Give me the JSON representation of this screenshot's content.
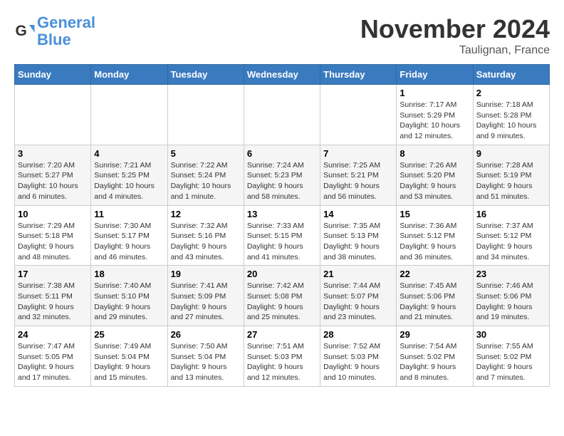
{
  "header": {
    "logo_line1": "General",
    "logo_line2": "Blue",
    "month": "November 2024",
    "location": "Taulignan, France"
  },
  "weekdays": [
    "Sunday",
    "Monday",
    "Tuesday",
    "Wednesday",
    "Thursday",
    "Friday",
    "Saturday"
  ],
  "weeks": [
    [
      {
        "day": "",
        "info": ""
      },
      {
        "day": "",
        "info": ""
      },
      {
        "day": "",
        "info": ""
      },
      {
        "day": "",
        "info": ""
      },
      {
        "day": "",
        "info": ""
      },
      {
        "day": "1",
        "info": "Sunrise: 7:17 AM\nSunset: 5:29 PM\nDaylight: 10 hours and 12 minutes."
      },
      {
        "day": "2",
        "info": "Sunrise: 7:18 AM\nSunset: 5:28 PM\nDaylight: 10 hours and 9 minutes."
      }
    ],
    [
      {
        "day": "3",
        "info": "Sunrise: 7:20 AM\nSunset: 5:27 PM\nDaylight: 10 hours and 6 minutes."
      },
      {
        "day": "4",
        "info": "Sunrise: 7:21 AM\nSunset: 5:25 PM\nDaylight: 10 hours and 4 minutes."
      },
      {
        "day": "5",
        "info": "Sunrise: 7:22 AM\nSunset: 5:24 PM\nDaylight: 10 hours and 1 minute."
      },
      {
        "day": "6",
        "info": "Sunrise: 7:24 AM\nSunset: 5:23 PM\nDaylight: 9 hours and 58 minutes."
      },
      {
        "day": "7",
        "info": "Sunrise: 7:25 AM\nSunset: 5:21 PM\nDaylight: 9 hours and 56 minutes."
      },
      {
        "day": "8",
        "info": "Sunrise: 7:26 AM\nSunset: 5:20 PM\nDaylight: 9 hours and 53 minutes."
      },
      {
        "day": "9",
        "info": "Sunrise: 7:28 AM\nSunset: 5:19 PM\nDaylight: 9 hours and 51 minutes."
      }
    ],
    [
      {
        "day": "10",
        "info": "Sunrise: 7:29 AM\nSunset: 5:18 PM\nDaylight: 9 hours and 48 minutes."
      },
      {
        "day": "11",
        "info": "Sunrise: 7:30 AM\nSunset: 5:17 PM\nDaylight: 9 hours and 46 minutes."
      },
      {
        "day": "12",
        "info": "Sunrise: 7:32 AM\nSunset: 5:16 PM\nDaylight: 9 hours and 43 minutes."
      },
      {
        "day": "13",
        "info": "Sunrise: 7:33 AM\nSunset: 5:15 PM\nDaylight: 9 hours and 41 minutes."
      },
      {
        "day": "14",
        "info": "Sunrise: 7:35 AM\nSunset: 5:13 PM\nDaylight: 9 hours and 38 minutes."
      },
      {
        "day": "15",
        "info": "Sunrise: 7:36 AM\nSunset: 5:12 PM\nDaylight: 9 hours and 36 minutes."
      },
      {
        "day": "16",
        "info": "Sunrise: 7:37 AM\nSunset: 5:12 PM\nDaylight: 9 hours and 34 minutes."
      }
    ],
    [
      {
        "day": "17",
        "info": "Sunrise: 7:38 AM\nSunset: 5:11 PM\nDaylight: 9 hours and 32 minutes."
      },
      {
        "day": "18",
        "info": "Sunrise: 7:40 AM\nSunset: 5:10 PM\nDaylight: 9 hours and 29 minutes."
      },
      {
        "day": "19",
        "info": "Sunrise: 7:41 AM\nSunset: 5:09 PM\nDaylight: 9 hours and 27 minutes."
      },
      {
        "day": "20",
        "info": "Sunrise: 7:42 AM\nSunset: 5:08 PM\nDaylight: 9 hours and 25 minutes."
      },
      {
        "day": "21",
        "info": "Sunrise: 7:44 AM\nSunset: 5:07 PM\nDaylight: 9 hours and 23 minutes."
      },
      {
        "day": "22",
        "info": "Sunrise: 7:45 AM\nSunset: 5:06 PM\nDaylight: 9 hours and 21 minutes."
      },
      {
        "day": "23",
        "info": "Sunrise: 7:46 AM\nSunset: 5:06 PM\nDaylight: 9 hours and 19 minutes."
      }
    ],
    [
      {
        "day": "24",
        "info": "Sunrise: 7:47 AM\nSunset: 5:05 PM\nDaylight: 9 hours and 17 minutes."
      },
      {
        "day": "25",
        "info": "Sunrise: 7:49 AM\nSunset: 5:04 PM\nDaylight: 9 hours and 15 minutes."
      },
      {
        "day": "26",
        "info": "Sunrise: 7:50 AM\nSunset: 5:04 PM\nDaylight: 9 hours and 13 minutes."
      },
      {
        "day": "27",
        "info": "Sunrise: 7:51 AM\nSunset: 5:03 PM\nDaylight: 9 hours and 12 minutes."
      },
      {
        "day": "28",
        "info": "Sunrise: 7:52 AM\nSunset: 5:03 PM\nDaylight: 9 hours and 10 minutes."
      },
      {
        "day": "29",
        "info": "Sunrise: 7:54 AM\nSunset: 5:02 PM\nDaylight: 9 hours and 8 minutes."
      },
      {
        "day": "30",
        "info": "Sunrise: 7:55 AM\nSunset: 5:02 PM\nDaylight: 9 hours and 7 minutes."
      }
    ]
  ]
}
